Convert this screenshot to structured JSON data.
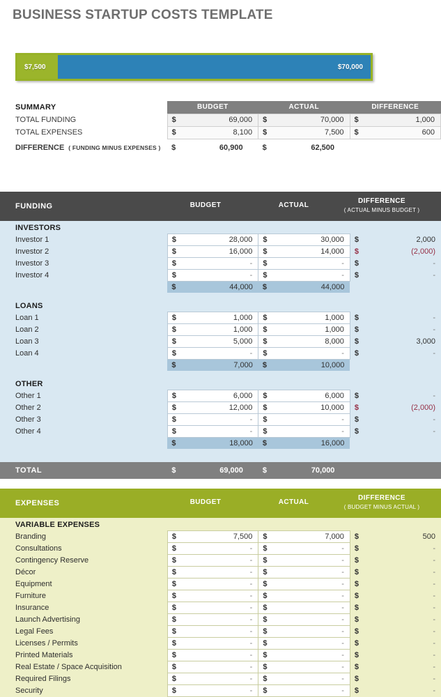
{
  "page": {
    "title": "BUSINESS STARTUP COSTS TEMPLATE"
  },
  "comparison_bar": {
    "left_label": "$7,500",
    "right_label": "$70,000",
    "left_color": "#9bb52b",
    "right_color": "#2d82b7"
  },
  "summary": {
    "title": "SUMMARY",
    "columns": [
      "BUDGET",
      "ACTUAL",
      "DIFFERENCE"
    ],
    "currency": "$",
    "rows": [
      {
        "label": "TOTAL FUNDING",
        "budget": "69,000",
        "actual": "70,000",
        "difference": "1,000"
      },
      {
        "label": "TOTAL EXPENSES",
        "budget": "8,100",
        "actual": "7,500",
        "difference": "600"
      }
    ],
    "difference_row": {
      "label": "DIFFERENCE",
      "note": "( FUNDING MINUS EXPENSES )",
      "budget": "60,900",
      "actual": "62,500"
    }
  },
  "funding": {
    "title": "FUNDING",
    "columns": {
      "budget": "BUDGET",
      "actual": "ACTUAL",
      "difference": "DIFFERENCE",
      "difference_note": "( ACTUAL MINUS BUDGET )"
    },
    "currency": "$",
    "header_color": "#4a4a4a",
    "body_color": "#d9e8f2",
    "groups": [
      {
        "name": "INVESTORS",
        "items": [
          {
            "label": "Investor 1",
            "budget": "28,000",
            "actual": "30,000",
            "difference": "2,000",
            "negative": false
          },
          {
            "label": "Investor 2",
            "budget": "16,000",
            "actual": "14,000",
            "difference": "(2,000)",
            "negative": true
          },
          {
            "label": "Investor 3",
            "budget": "-",
            "actual": "-",
            "difference": "-",
            "negative": false
          },
          {
            "label": "Investor 4",
            "budget": "-",
            "actual": "-",
            "difference": "-",
            "negative": false
          }
        ],
        "subtotal": {
          "budget": "44,000",
          "actual": "44,000"
        }
      },
      {
        "name": "LOANS",
        "items": [
          {
            "label": "Loan 1",
            "budget": "1,000",
            "actual": "1,000",
            "difference": "-",
            "negative": false
          },
          {
            "label": "Loan 2",
            "budget": "1,000",
            "actual": "1,000",
            "difference": "-",
            "negative": false
          },
          {
            "label": "Loan 3",
            "budget": "5,000",
            "actual": "8,000",
            "difference": "3,000",
            "negative": false
          },
          {
            "label": "Loan 4",
            "budget": "-",
            "actual": "-",
            "difference": "-",
            "negative": false
          }
        ],
        "subtotal": {
          "budget": "7,000",
          "actual": "10,000"
        }
      },
      {
        "name": "OTHER",
        "items": [
          {
            "label": "Other 1",
            "budget": "6,000",
            "actual": "6,000",
            "difference": "-",
            "negative": false
          },
          {
            "label": "Other 2",
            "budget": "12,000",
            "actual": "10,000",
            "difference": "(2,000)",
            "negative": true
          },
          {
            "label": "Other 3",
            "budget": "-",
            "actual": "-",
            "difference": "-",
            "negative": false
          },
          {
            "label": "Other 4",
            "budget": "-",
            "actual": "-",
            "difference": "-",
            "negative": false
          }
        ],
        "subtotal": {
          "budget": "18,000",
          "actual": "16,000"
        }
      }
    ],
    "total": {
      "label": "TOTAL",
      "budget": "69,000",
      "actual": "70,000"
    }
  },
  "expenses": {
    "title": "EXPENSES",
    "columns": {
      "budget": "BUDGET",
      "actual": "ACTUAL",
      "difference": "DIFFERENCE",
      "difference_note": "( BUDGET MINUS ACTUAL )"
    },
    "currency": "$",
    "header_color": "#9aae26",
    "body_color": "#eef0c8",
    "groups": [
      {
        "name": "VARIABLE EXPENSES",
        "items": [
          {
            "label": "Branding",
            "budget": "7,500",
            "actual": "7,000",
            "difference": "500",
            "negative": false
          },
          {
            "label": "Consultations",
            "budget": "-",
            "actual": "-",
            "difference": "-",
            "negative": false
          },
          {
            "label": "Contingency Reserve",
            "budget": "-",
            "actual": "-",
            "difference": "-",
            "negative": false
          },
          {
            "label": "Décor",
            "budget": "-",
            "actual": "-",
            "difference": "-",
            "negative": false
          },
          {
            "label": "Equipment",
            "budget": "-",
            "actual": "-",
            "difference": "-",
            "negative": false
          },
          {
            "label": "Furniture",
            "budget": "-",
            "actual": "-",
            "difference": "-",
            "negative": false
          },
          {
            "label": "Insurance",
            "budget": "-",
            "actual": "-",
            "difference": "-",
            "negative": false
          },
          {
            "label": "Launch Advertising",
            "budget": "-",
            "actual": "-",
            "difference": "-",
            "negative": false
          },
          {
            "label": "Legal Fees",
            "budget": "-",
            "actual": "-",
            "difference": "-",
            "negative": false
          },
          {
            "label": "Licenses / Permits",
            "budget": "-",
            "actual": "-",
            "difference": "-",
            "negative": false
          },
          {
            "label": "Printed Materials",
            "budget": "-",
            "actual": "-",
            "difference": "-",
            "negative": false
          },
          {
            "label": "Real Estate / Space Acquisition",
            "budget": "-",
            "actual": "-",
            "difference": "-",
            "negative": false
          },
          {
            "label": "Required Filings",
            "budget": "-",
            "actual": "-",
            "difference": "-",
            "negative": false
          },
          {
            "label": "Security",
            "budget": "-",
            "actual": "-",
            "difference": "-",
            "negative": false
          }
        ]
      }
    ]
  }
}
